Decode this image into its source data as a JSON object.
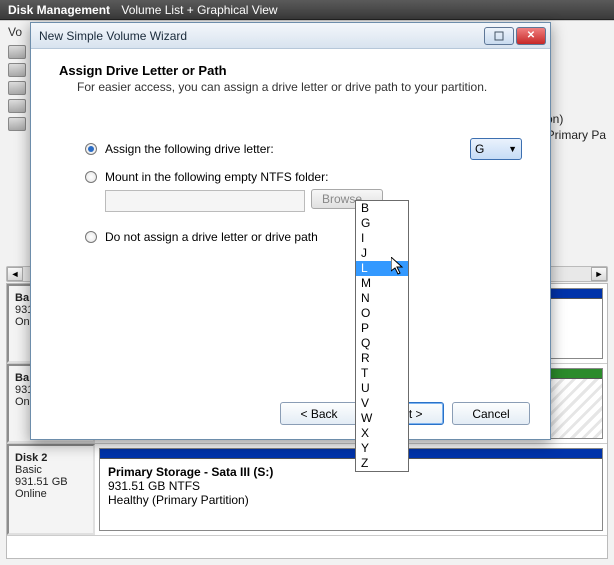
{
  "topbar": {
    "title": "Disk Management",
    "subtitle": "Volume List + Graphical View"
  },
  "volumes_header": "Vo",
  "background_text": {
    "line1": "tion)",
    "line2": ", Primary Pa"
  },
  "disks": {
    "d0": {
      "name": "Ba",
      "size": "931",
      "status": "On"
    },
    "d1": {
      "name": "Ba",
      "size": "931",
      "status": "On"
    },
    "d2": {
      "name": "Disk 2",
      "type": "Basic",
      "size": "931.51 GB",
      "status": "Online",
      "vol_name": "Primary Storage - Sata III  (S:)",
      "vol_size": "931.51 GB NTFS",
      "vol_status": "Healthy (Primary Partition)"
    }
  },
  "wizard": {
    "title": "New Simple Volume Wizard",
    "heading": "Assign Drive Letter or Path",
    "subheading": "For easier access, you can assign a drive letter or drive path to your partition.",
    "opt1": "Assign the following drive letter:",
    "opt2": "Mount in the following empty NTFS folder:",
    "opt3": "Do not assign a drive letter or drive path",
    "selected_letter": "G",
    "folder_path": "",
    "browse": "Browse...",
    "buttons": {
      "back": "< Back",
      "next": "Next >",
      "cancel": "Cancel"
    }
  },
  "dropdown": {
    "options": [
      "B",
      "G",
      "I",
      "J",
      "L",
      "M",
      "N",
      "O",
      "P",
      "Q",
      "R",
      "T",
      "U",
      "V",
      "W",
      "X",
      "Y",
      "Z"
    ],
    "highlighted": "L"
  }
}
